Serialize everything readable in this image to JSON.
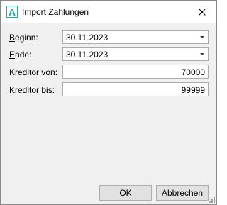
{
  "window": {
    "title": "Import Zahlungen",
    "app_icon_letter": "A",
    "app_icon_color": "#2aa79b",
    "close_icon": "close-icon"
  },
  "form": {
    "beginn": {
      "label_first": "B",
      "label_rest": "eginn:",
      "value": "30.11.2023"
    },
    "ende": {
      "label_first": "E",
      "label_rest": "nde:",
      "value": "30.11.2023"
    },
    "kreditor_von": {
      "label": "Kreditor von:",
      "value": "70000"
    },
    "kreditor_bis": {
      "label": "Kreditor bis:",
      "value": "99999"
    }
  },
  "buttons": {
    "ok": "OK",
    "cancel": "Abbrechen"
  }
}
